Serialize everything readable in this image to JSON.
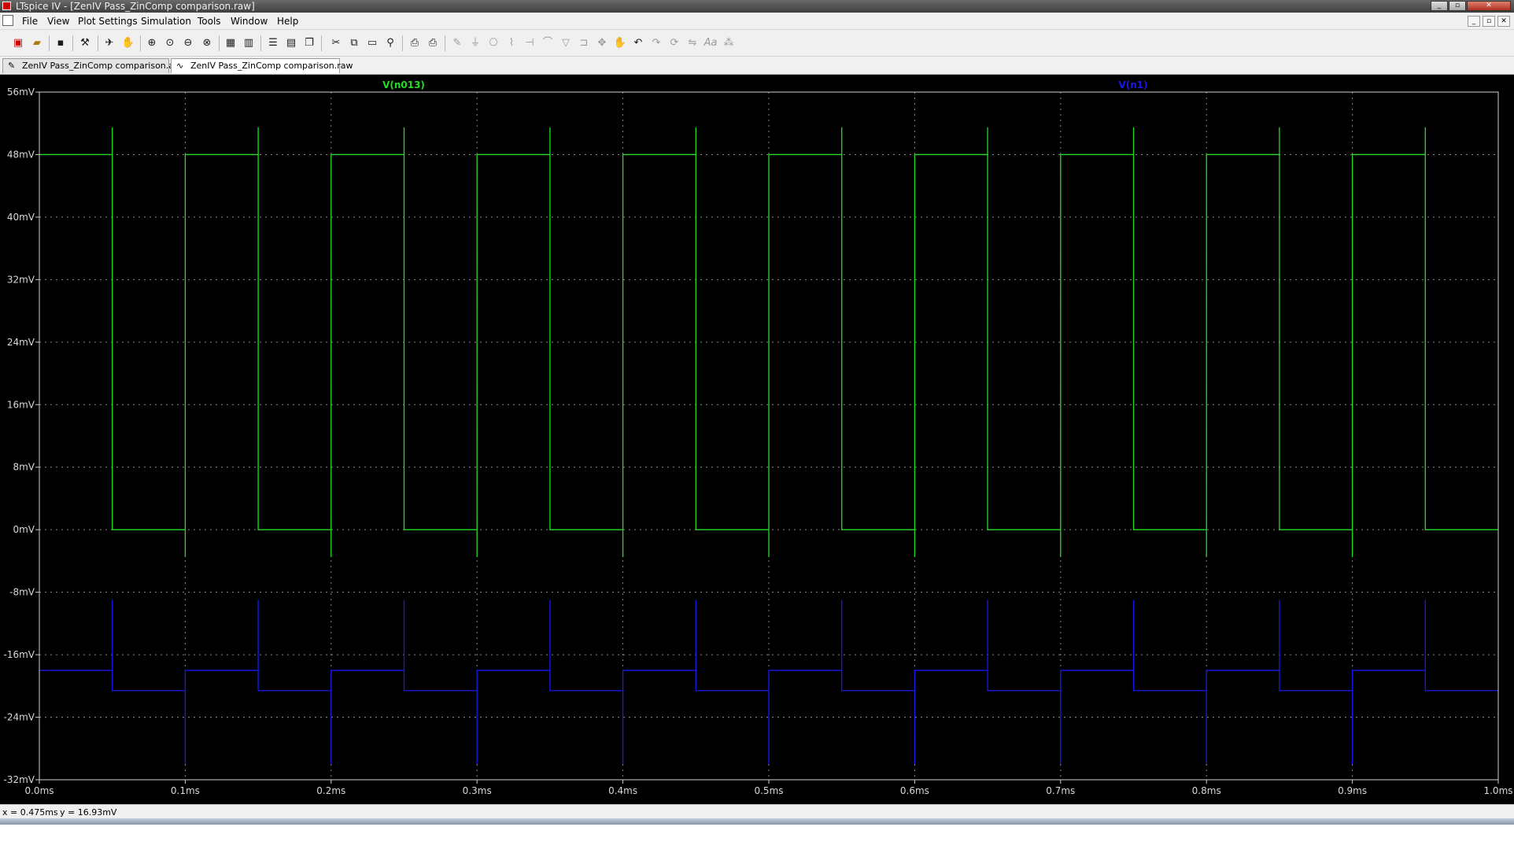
{
  "window": {
    "title": "LTspice IV - [ZenIV Pass_ZinComp comparison.raw]",
    "buttons": [
      "minimize",
      "restore",
      "close"
    ]
  },
  "menubar": {
    "items": [
      "File",
      "View",
      "Plot Settings",
      "Simulation",
      "Tools",
      "Window",
      "Help"
    ],
    "mdi_buttons": [
      "minimize",
      "restore",
      "close"
    ]
  },
  "toolbar": {
    "icons": [
      "new-schematic-icon",
      "open-icon",
      "save-icon",
      "control-panel-icon",
      "run-icon",
      "halt-icon",
      "zoom-in-icon",
      "zoom-pan-icon",
      "zoom-out-icon",
      "zoom-cancel-icon",
      "autorange-icon",
      "mark-unref-icon",
      "tile-horizontal-icon",
      "tile-vertical-icon",
      "cascade-icon",
      "cut-icon",
      "copy-icon",
      "paste-icon",
      "find-icon",
      "print-setup-icon",
      "print-icon",
      "wire-icon",
      "ground-icon",
      "label-net-icon",
      "resistor-icon",
      "capacitor-icon",
      "inductor-icon",
      "diode-icon",
      "component-icon",
      "move-icon",
      "drag-icon",
      "undo-icon",
      "redo-icon",
      "rotate-icon",
      "mirror-icon",
      "text-icon",
      "spice-directive-icon"
    ]
  },
  "tabs": [
    {
      "label": "ZenIV Pass_ZinComp comparison.asc",
      "active": false
    },
    {
      "label": "ZenIV Pass_ZinComp comparison.raw",
      "active": true
    }
  ],
  "chart_data": {
    "type": "line",
    "xlim": [
      0.0,
      1.0
    ],
    "ylim": [
      -32,
      56
    ],
    "x_unit": "ms",
    "y_unit": "mV",
    "x_ticks": [
      "0.0ms",
      "0.1ms",
      "0.2ms",
      "0.3ms",
      "0.4ms",
      "0.5ms",
      "0.6ms",
      "0.7ms",
      "0.8ms",
      "0.9ms",
      "1.0ms"
    ],
    "y_ticks": [
      "56mV",
      "48mV",
      "40mV",
      "32mV",
      "24mV",
      "16mV",
      "8mV",
      "0mV",
      "-8mV",
      "-16mV",
      "-24mV",
      "-32mV"
    ],
    "grid": true,
    "series": [
      {
        "name": "V(n013)",
        "color": "#22dd22",
        "period_ms": 0.1,
        "duty_high_fraction": 0.5,
        "high_mV": 48,
        "low_mV": 0,
        "start_level": "high",
        "rising_overshoot_mV": 51.5,
        "falling_undershoot_mV": -3.5
      },
      {
        "name": "V(n1)",
        "color": "#1818ee",
        "period_ms": 0.1,
        "duty_high_fraction": 0.5,
        "high_mV": -18,
        "low_mV": -20.6,
        "start_level": "high",
        "rising_overshoot_mV": -9.0,
        "falling_undershoot_mV": -30.0
      }
    ]
  },
  "cursor": {
    "x_label": "x = 0.475ms",
    "y_label": "y = 16.93mV"
  }
}
